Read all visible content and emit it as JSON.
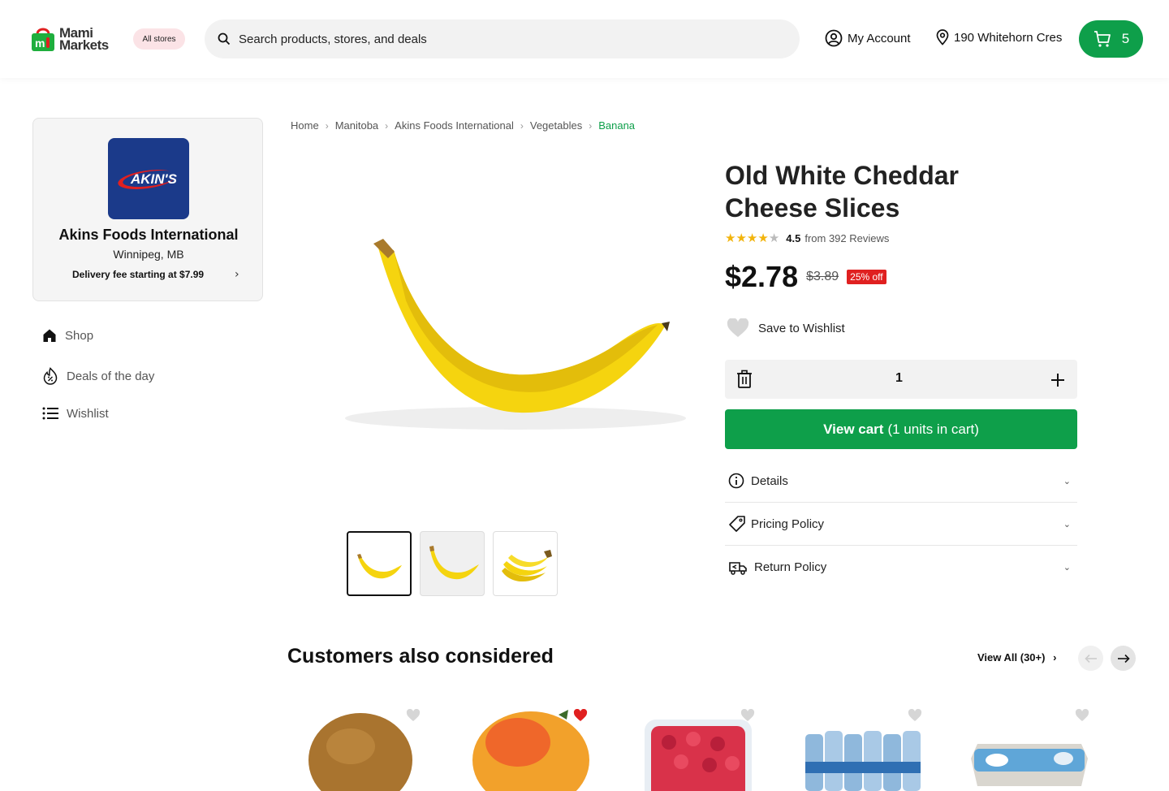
{
  "header": {
    "logo_line1": "Mami",
    "logo_line2": "Markets",
    "all_stores": "All stores",
    "search_placeholder": "Search products, stores, and deals",
    "account": "My Account",
    "address": "190 Whitehorn Cres",
    "cart_count": "5"
  },
  "store": {
    "logo_text": "AKIN'S",
    "name": "Akins Foods International",
    "location": "Winnipeg, MB",
    "delivery_fee": "Delivery fee starting at $7.99"
  },
  "nav": {
    "shop": "Shop",
    "deals": "Deals of the day",
    "wishlist": "Wishlist"
  },
  "breadcrumb": [
    "Home",
    "Manitoba",
    "Akins Foods International",
    "Vegetables",
    "Banana"
  ],
  "product": {
    "title": "Old White Cheddar Cheese Slices",
    "rating": "4.5",
    "reviews": "from 392 Reviews",
    "rating_value": 4.5,
    "price": "$2.78",
    "old_price": "$3.89",
    "discount": "25% off",
    "save_wishlist": "Save to Wishlist",
    "quantity": "1",
    "view_cart_bold": "View cart",
    "view_cart_rest": "(1 units in cart)",
    "details": "Details",
    "pricing_policy": "Pricing Policy",
    "return_policy": "Return Policy"
  },
  "related": {
    "title": "Customers also considered",
    "view_all": "View All (30+)",
    "items": [
      {
        "name": "kiwi",
        "favorited": false
      },
      {
        "name": "mango",
        "favorited": true
      },
      {
        "name": "raspberries",
        "favorited": false
      },
      {
        "name": "water bottles",
        "favorited": false
      },
      {
        "name": "eggs",
        "favorited": false
      }
    ]
  },
  "colors": {
    "brand_green": "#0e9f4a",
    "sale_red": "#e02020",
    "star": "#f2b40d",
    "store_blue": "#1b3a8a"
  }
}
